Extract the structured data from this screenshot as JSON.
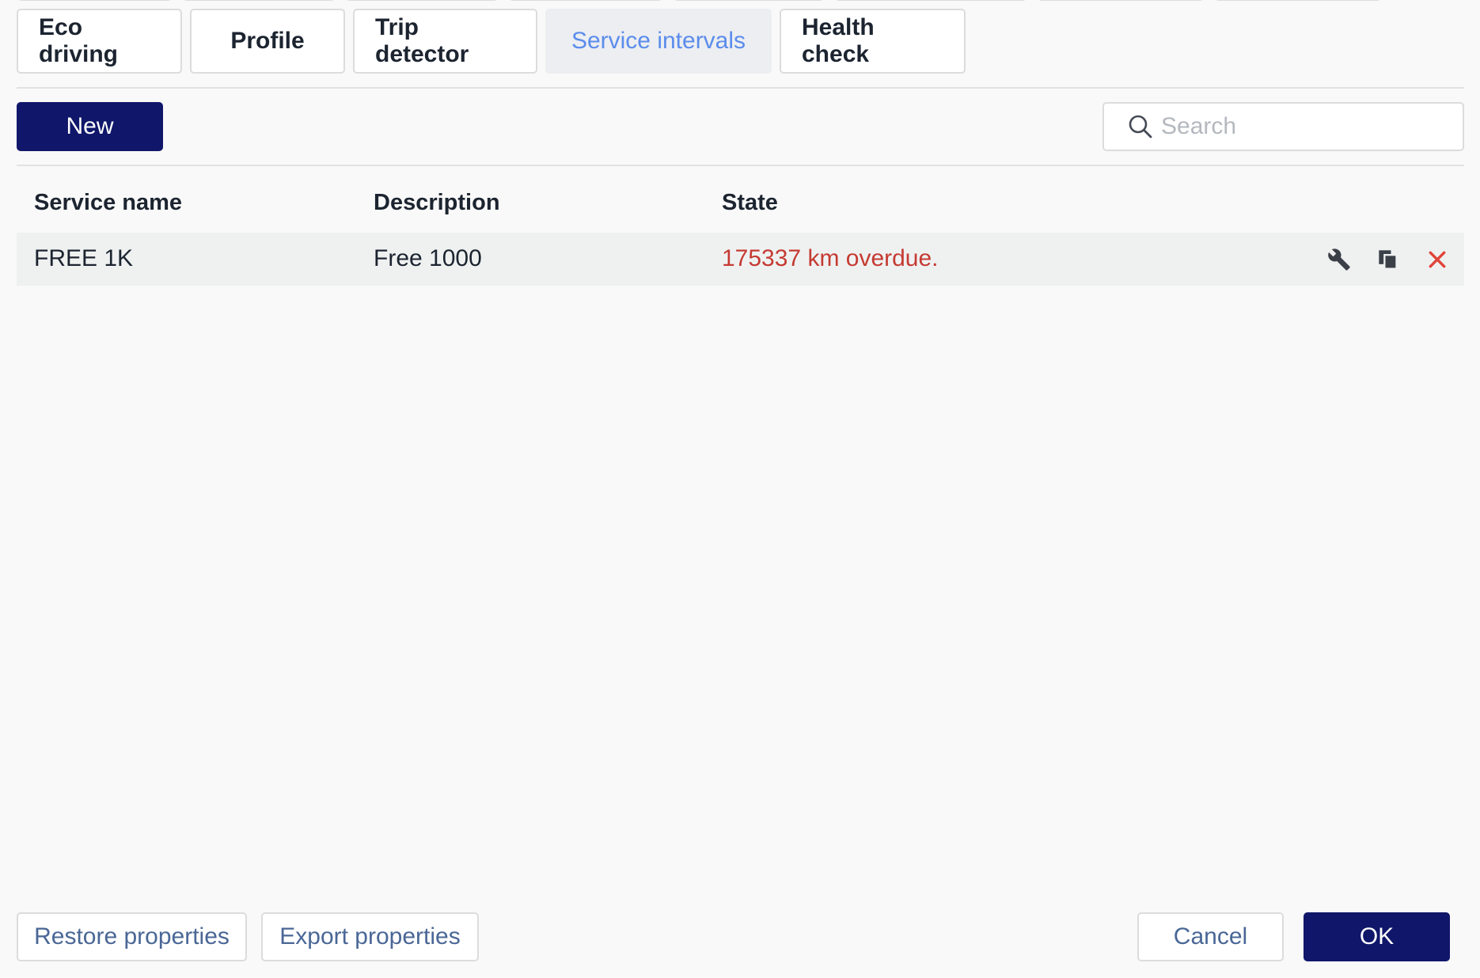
{
  "tabs": [
    {
      "label": "Eco driving",
      "active": false
    },
    {
      "label": "Profile",
      "active": false
    },
    {
      "label": "Trip detector",
      "active": false
    },
    {
      "label": "Service intervals",
      "active": true
    },
    {
      "label": "Health check",
      "active": false
    }
  ],
  "toolbar": {
    "new_label": "New",
    "search_placeholder": "Search",
    "search_value": ""
  },
  "table": {
    "columns": [
      "Service name",
      "Description",
      "State"
    ],
    "rows": [
      {
        "service_name": "FREE 1K",
        "description": "Free 1000",
        "state": "175337 km overdue.",
        "state_color": "#c53a32",
        "actions": [
          "wrench-icon",
          "copy-icon",
          "close-icon"
        ]
      }
    ]
  },
  "footer": {
    "restore_label": "Restore properties",
    "export_label": "Export properties",
    "cancel_label": "Cancel",
    "ok_label": "OK"
  },
  "colors": {
    "primary": "#10176a",
    "active_tab_text": "#5b8cec",
    "danger": "#c53a32",
    "delete_icon": "#e0443a",
    "secondary_text": "#4a6796"
  }
}
